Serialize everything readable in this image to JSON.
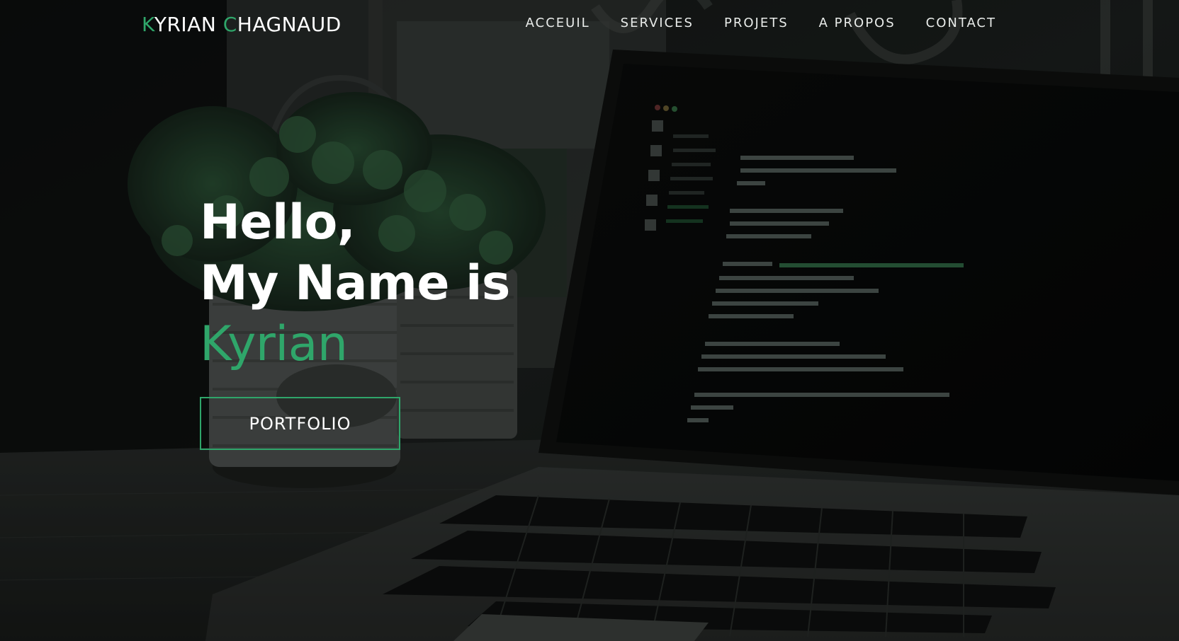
{
  "header": {
    "logo": {
      "first_initial": "K",
      "first_rest": "YRIAN",
      "last_initial": "C",
      "last_rest": "HAGNAUD"
    },
    "nav": [
      {
        "label": "ACCEUIL"
      },
      {
        "label": "SERVICES"
      },
      {
        "label": "PROJETS"
      },
      {
        "label": "A PROPOS"
      },
      {
        "label": "CONTACT"
      }
    ]
  },
  "hero": {
    "line1": "Hello,",
    "line2": "My Name is",
    "name": "Kyrian",
    "cta_label": "PORTFOLIO"
  },
  "theme": {
    "accent": "#2fa66a",
    "text": "#ffffff",
    "background": "#0f1211"
  },
  "background_image": {
    "depicts": "laptop-with-code-editor-and-potted-plants"
  }
}
